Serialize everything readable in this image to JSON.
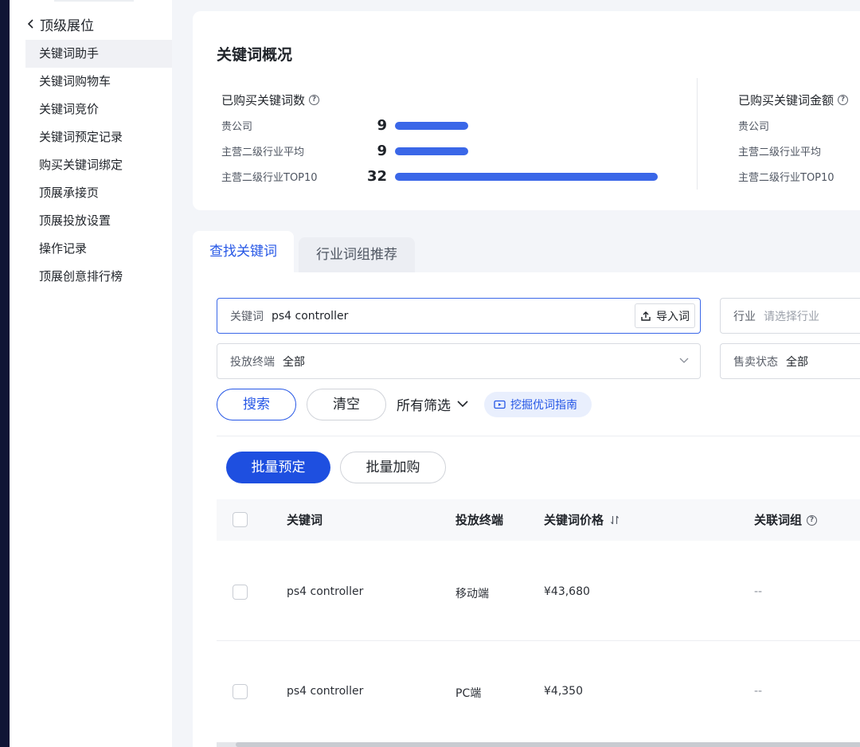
{
  "sidebar": {
    "back_label": "顶级展位",
    "items": [
      {
        "label": "关键词助手",
        "active": true
      },
      {
        "label": "关键词购物车"
      },
      {
        "label": "关键词竞价"
      },
      {
        "label": "关键词预定记录"
      },
      {
        "label": "购买关键词绑定"
      },
      {
        "label": "顶展承接页"
      },
      {
        "label": "顶展投放设置"
      },
      {
        "label": "操作记录"
      },
      {
        "label": "顶展创意排行榜"
      }
    ]
  },
  "overview": {
    "title": "关键词概况",
    "purchased_count": {
      "label": "已购买关键词数",
      "rows": [
        {
          "label": "贵公司",
          "value": "9",
          "bar_fraction": 0.28
        },
        {
          "label": "主营二级行业平均",
          "value": "9",
          "bar_fraction": 0.28
        },
        {
          "label": "主营二级行业TOP10",
          "value": "32",
          "bar_fraction": 1.0
        }
      ]
    },
    "purchased_amount": {
      "label": "已购买关键词金额",
      "rows": [
        {
          "label": "贵公司"
        },
        {
          "label": "主营二级行业平均"
        },
        {
          "label": "主营二级行业TOP10"
        }
      ]
    }
  },
  "tabs": [
    {
      "label": "查找关键词",
      "active": true
    },
    {
      "label": "行业词组推荐"
    }
  ],
  "filters": {
    "keyword": {
      "label": "关键词",
      "value": "ps4 controller",
      "import_label": "导入词"
    },
    "industry": {
      "label": "行业",
      "placeholder": "请选择行业"
    },
    "terminal": {
      "label": "投放终端",
      "value": "全部"
    },
    "sale_status": {
      "label": "售卖状态",
      "value": "全部"
    },
    "search_label": "搜索",
    "clear_label": "清空",
    "all_filters_label": "所有筛选",
    "guide_label": "挖掘优词指南"
  },
  "actions": {
    "batch_reserve": "批量预定",
    "batch_add": "批量加购"
  },
  "table": {
    "headers": {
      "keyword": "关键词",
      "terminal": "投放终端",
      "price": "关键词价格",
      "group": "关联词组"
    },
    "rows": [
      {
        "keyword": "ps4 controller",
        "terminal": "移动端",
        "price": "¥43,680",
        "group": "--"
      },
      {
        "keyword": "ps4 controller",
        "terminal": "PC端",
        "price": "¥4,350",
        "group": "--"
      }
    ]
  },
  "colors": {
    "accent": "#2657e6",
    "primary_button": "#1e4fe0",
    "bar": "#3a67e8",
    "sidebar_edge": "#0f1535"
  }
}
